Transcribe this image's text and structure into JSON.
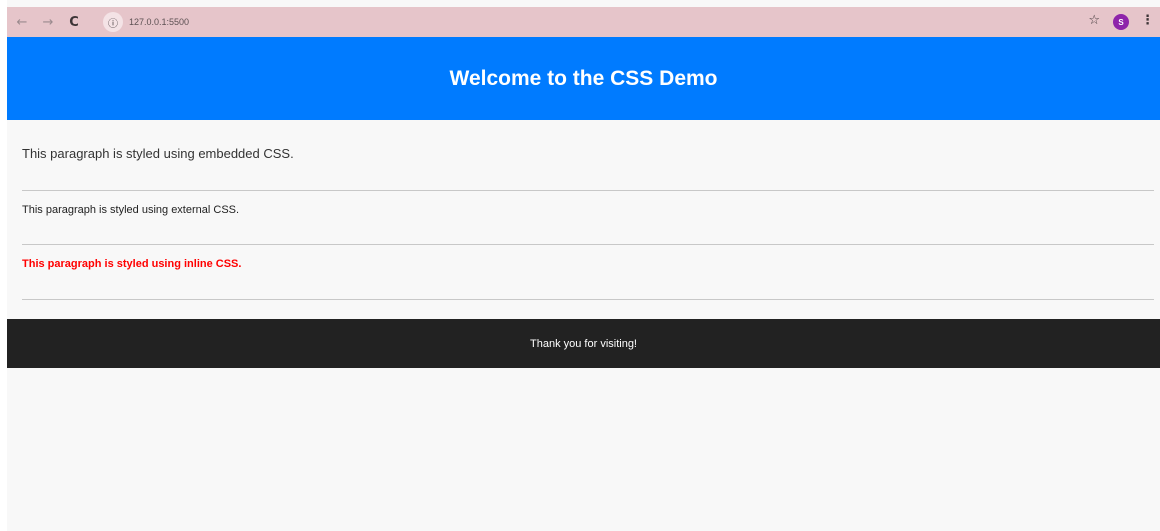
{
  "browser": {
    "back_icon": "arrow-left-icon",
    "back_glyph": "←",
    "forward_icon": "arrow-right-icon",
    "forward_glyph": "→",
    "reload_icon": "reload-icon",
    "reload_glyph": "C",
    "info_glyph": "ⓘ",
    "url": "127.0.0.1:5500",
    "star_glyph": "☆",
    "profile_initial": "S",
    "menu_glyph": "⋮",
    "toolbar_color": "#e6c5ca",
    "profile_color": "#8e24aa"
  },
  "header": {
    "title": "Welcome to the CSS Demo",
    "background": "#007bff"
  },
  "paragraphs": {
    "embedded": "This paragraph is styled using embedded CSS.",
    "external": "This paragraph is styled using external CSS.",
    "inline": "This paragraph is styled using inline CSS.",
    "inline_color": "#ff0000"
  },
  "footer": {
    "text": "Thank you for visiting!",
    "background": "#222222"
  }
}
